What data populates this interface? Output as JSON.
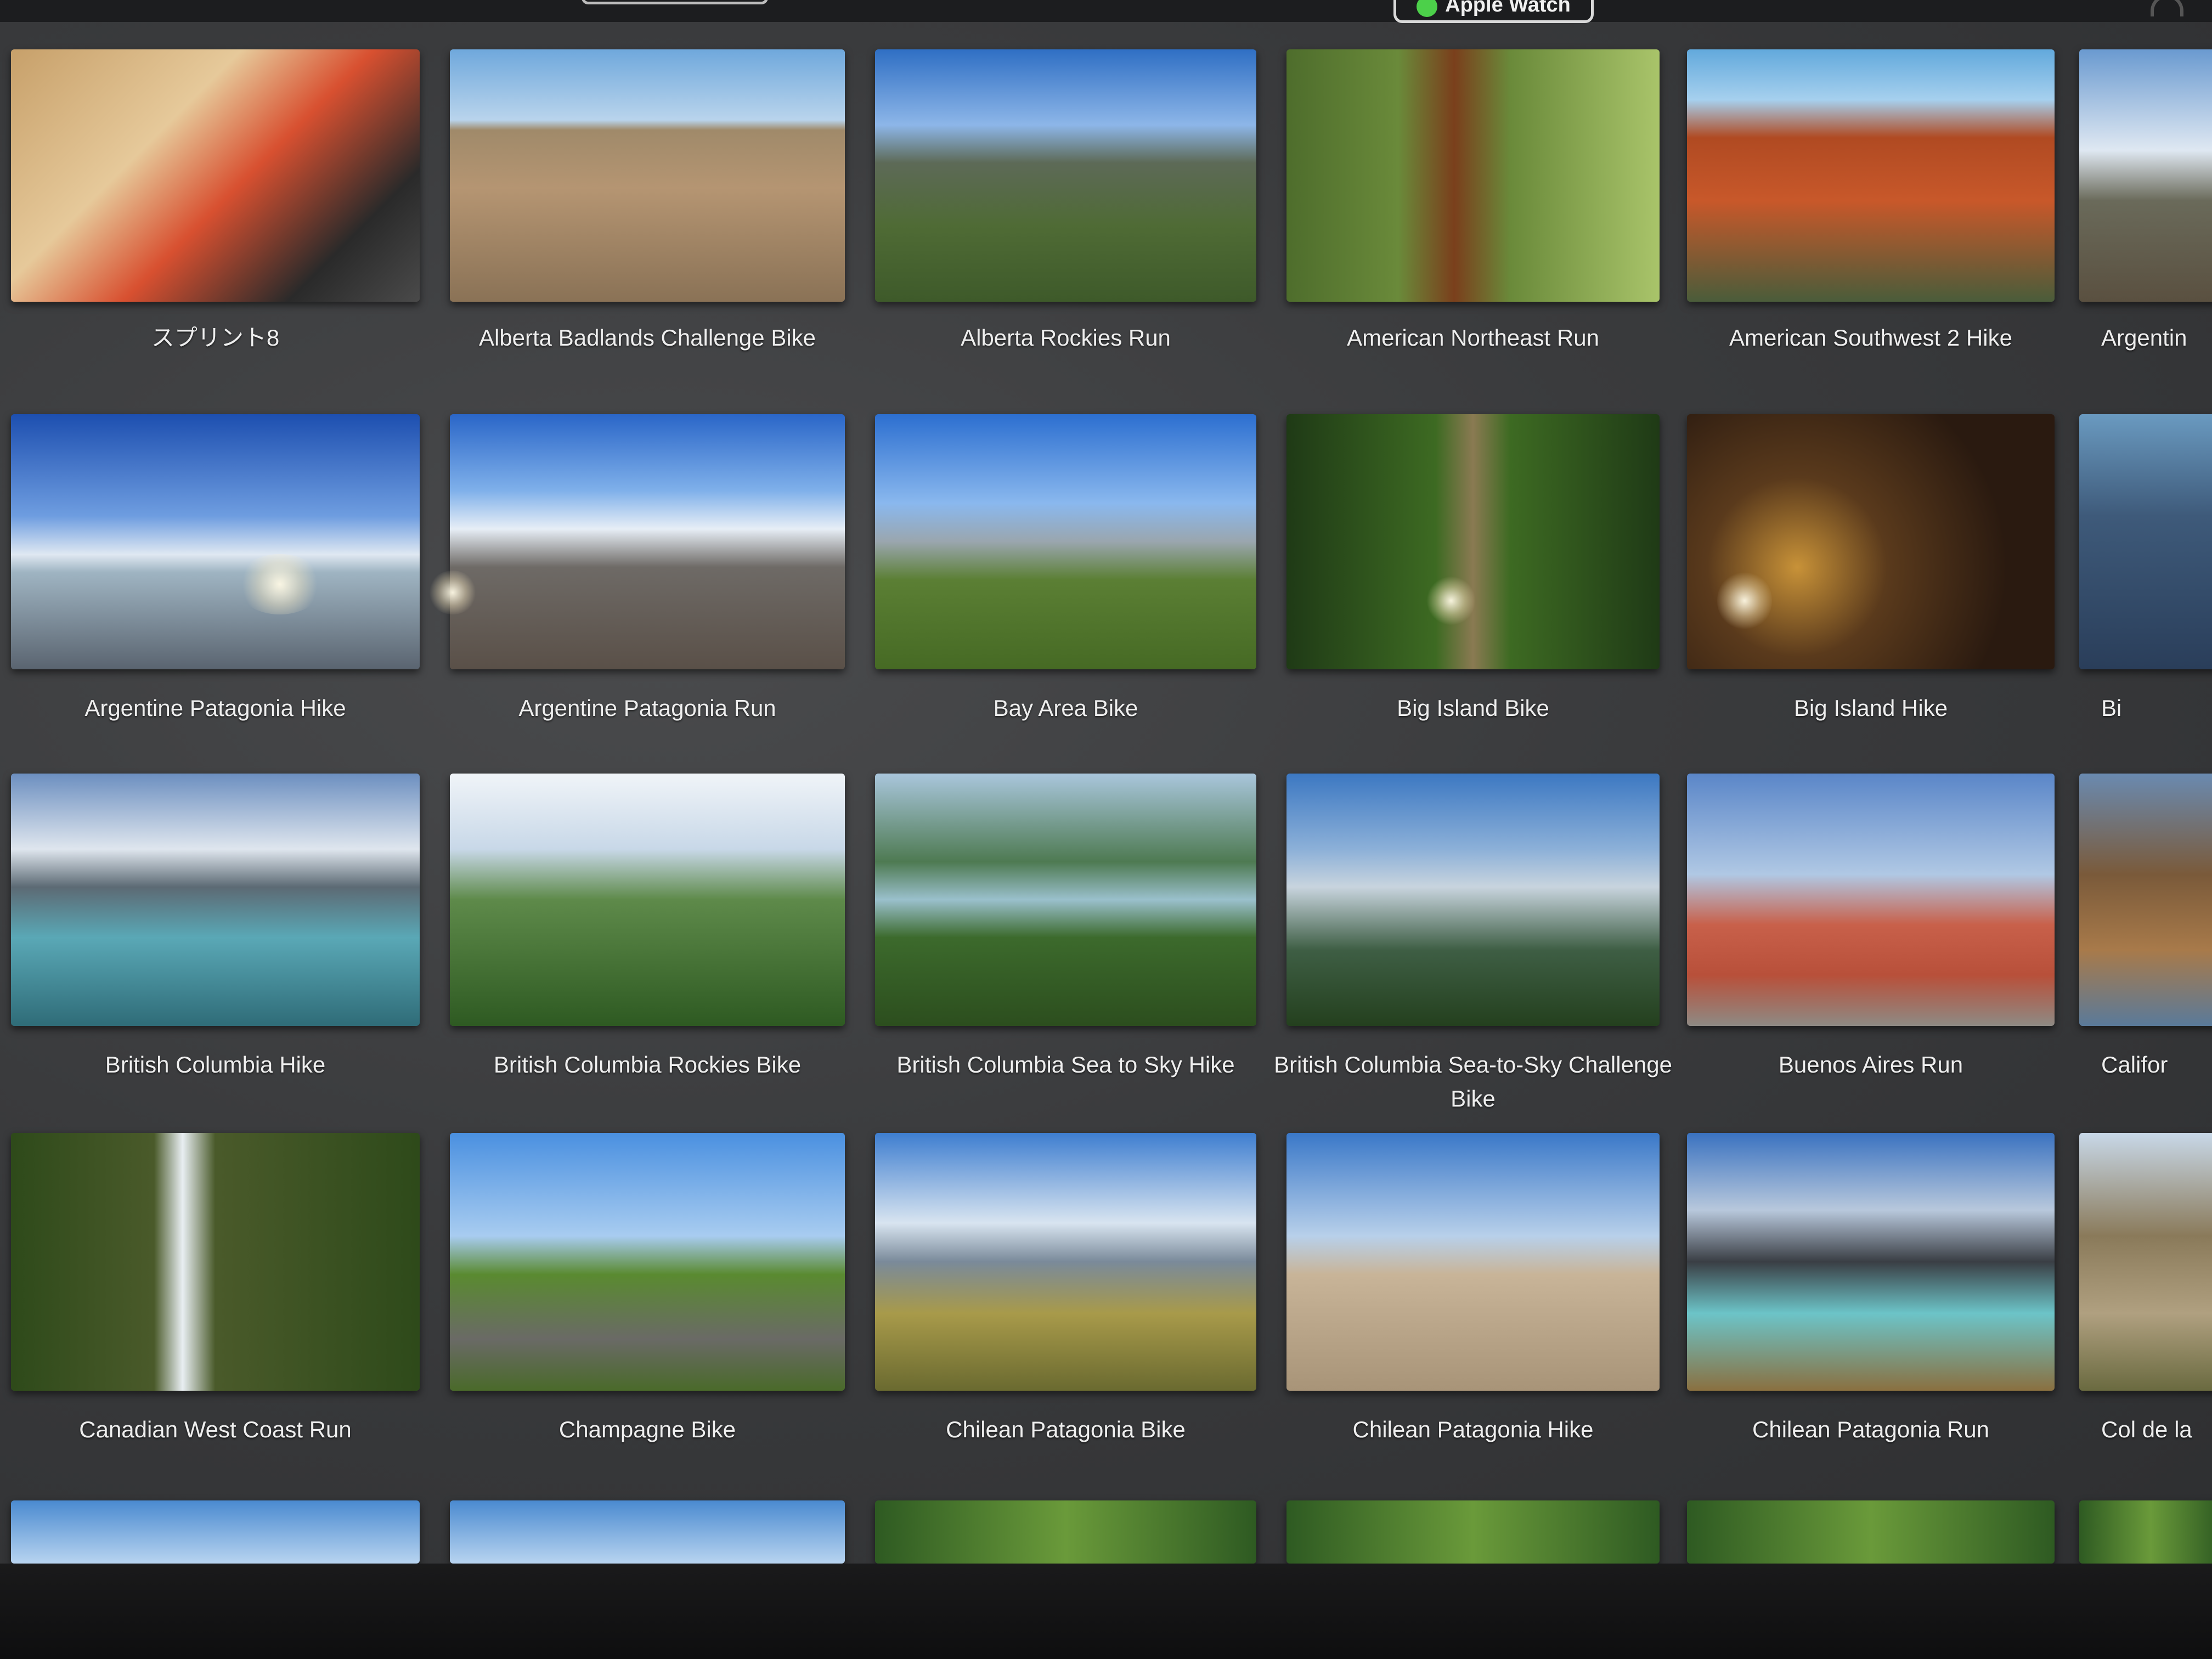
{
  "header": {
    "watch_label": "Apple Watch"
  },
  "rows": [
    [
      {
        "title": "スプリント8",
        "scene": "runner"
      },
      {
        "title": "Alberta Badlands Challenge Bike",
        "scene": "sky-badlands"
      },
      {
        "title": "Alberta Rockies Run",
        "scene": "sky-rockies"
      },
      {
        "title": "American Northeast Run",
        "scene": "bridge"
      },
      {
        "title": "American Southwest 2 Hike",
        "scene": "redrock"
      },
      {
        "title": "Argentin",
        "scene": "argentin"
      }
    ],
    [
      {
        "title": "Argentine Patagonia Hike",
        "scene": "glacier"
      },
      {
        "title": "Argentine Patagonia Run",
        "scene": "fitzroy"
      },
      {
        "title": "Bay Area Bike",
        "scene": "bayarea"
      },
      {
        "title": "Big Island Bike",
        "scene": "forestpath"
      },
      {
        "title": "Big Island Hike",
        "scene": "cave"
      },
      {
        "title": "Bi",
        "scene": "coastal"
      }
    ],
    [
      {
        "title": "British Columbia Hike",
        "scene": "bchike"
      },
      {
        "title": "British Columbia Rockies Bike",
        "scene": "bcrockies"
      },
      {
        "title": "British Columbia Sea to Sky Hike",
        "scene": "seasky"
      },
      {
        "title": "British Columbia Sea-to-Sky Challenge Bike",
        "scene": "seaskybike"
      },
      {
        "title": "Buenos Aires Run",
        "scene": "buenos"
      },
      {
        "title": "Califor",
        "scene": "californ"
      }
    ],
    [
      {
        "title": "Canadian West Coast Run",
        "scene": "waterfall"
      },
      {
        "title": "Champagne Bike",
        "scene": "champagne"
      },
      {
        "title": "Chilean Patagonia Bike",
        "scene": "chileanbike"
      },
      {
        "title": "Chilean Patagonia Hike",
        "scene": "penguin"
      },
      {
        "title": "Chilean Patagonia Run",
        "scene": "chileanrun"
      },
      {
        "title": "Col de la",
        "scene": "coldela"
      }
    ]
  ]
}
